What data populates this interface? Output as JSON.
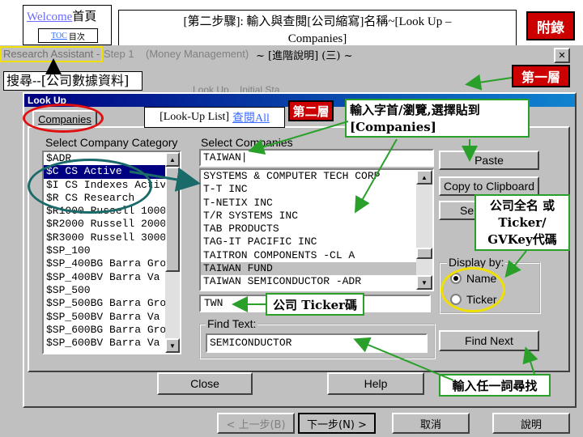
{
  "nav": {
    "welcome_link": "Welcome",
    "home_label": "首頁",
    "toc_link": "TOC",
    "toc_label": "目次"
  },
  "title_box": {
    "line1": "[第二步驟]: 輸入與查閱[公司縮寫]名稱~[Look Up –",
    "line2": "Companies]"
  },
  "appendix_button": "附錄",
  "breadcrumb_bar": {
    "research_assistant": "Research Assistant -",
    "step": "Step 1",
    "money_mgmt": "(Money Management)",
    "advanced": "~ [進階說明] (三) ~"
  },
  "level1_button": "第一層",
  "search_label": "搜尋--[公司數據資料]",
  "background_text": "Look Up... Initial Sta...",
  "window": {
    "title": "Look Up",
    "tab_companies": "Companies",
    "lookup_list_label": "[Look-Up List]",
    "lookup_all_label": "查閱All"
  },
  "level2_button": "第二層",
  "callout_input": "輸入字首/瀏覽,選擇貼到[Companies]",
  "category_panel": {
    "label": "Select Company Category",
    "items": [
      "$ADR",
      "$C CS Active",
      "$I CS Indexes Active <",
      "$R CS Research",
      "$R1000 Russell 1000",
      "$R2000 Russell 2000",
      "$R3000 Russell 3000",
      "$SP_100",
      "$SP_400BG Barra Gro",
      "$SP_400BV Barra Va",
      "$SP_500",
      "$SP_500BG Barra Gro",
      "$SP_500BV Barra Va",
      "$SP_600BG Barra Gro",
      "$SP_600BV Barra Va"
    ],
    "selected_index": 1
  },
  "companies_panel": {
    "label": "Select Companies",
    "input_value": "TAIWAN|",
    "items": [
      "SYSTEMS & COMPUTER TECH CORP",
      "T-T INC",
      "T-NETIX INC",
      "T/R SYSTEMS INC",
      "TAB PRODUCTS",
      "TAG-IT PACIFIC INC",
      "TAITRON COMPONENTS -CL A",
      "TAIWAN FUND",
      "TAIWAN SEMICONDUCTOR -ADR"
    ],
    "highlighted_index": 7,
    "ticker_value": "TWN"
  },
  "callout_ticker": "公司 Ticker碼",
  "find_text": {
    "label": "Find Text:",
    "value": "SEMICONDUCTOR"
  },
  "buttons": {
    "paste": "Paste",
    "copy": "Copy to Clipboard",
    "se": "Se",
    "find_next": "Find Next",
    "close": "Close",
    "help": "Help",
    "back": "< 上一步(B)",
    "next": "下一步(N) >",
    "cancel": "取消",
    "explain": "說明"
  },
  "display_by": {
    "label": "Display by:",
    "option_name": "Name",
    "option_ticker": "Ticker"
  },
  "callout_fullname": {
    "line1": "公司全名 或",
    "line2": "Ticker/",
    "line3": "GVKey代碼"
  },
  "callout_find": "輸入任一詞尋找",
  "colors": {
    "red_button": "#cc0000",
    "callout_border": "#2aa02a",
    "annotation_red": "#e01010",
    "annotation_teal": "#1a6a6a",
    "annotation_yellow": "#f0e000"
  }
}
